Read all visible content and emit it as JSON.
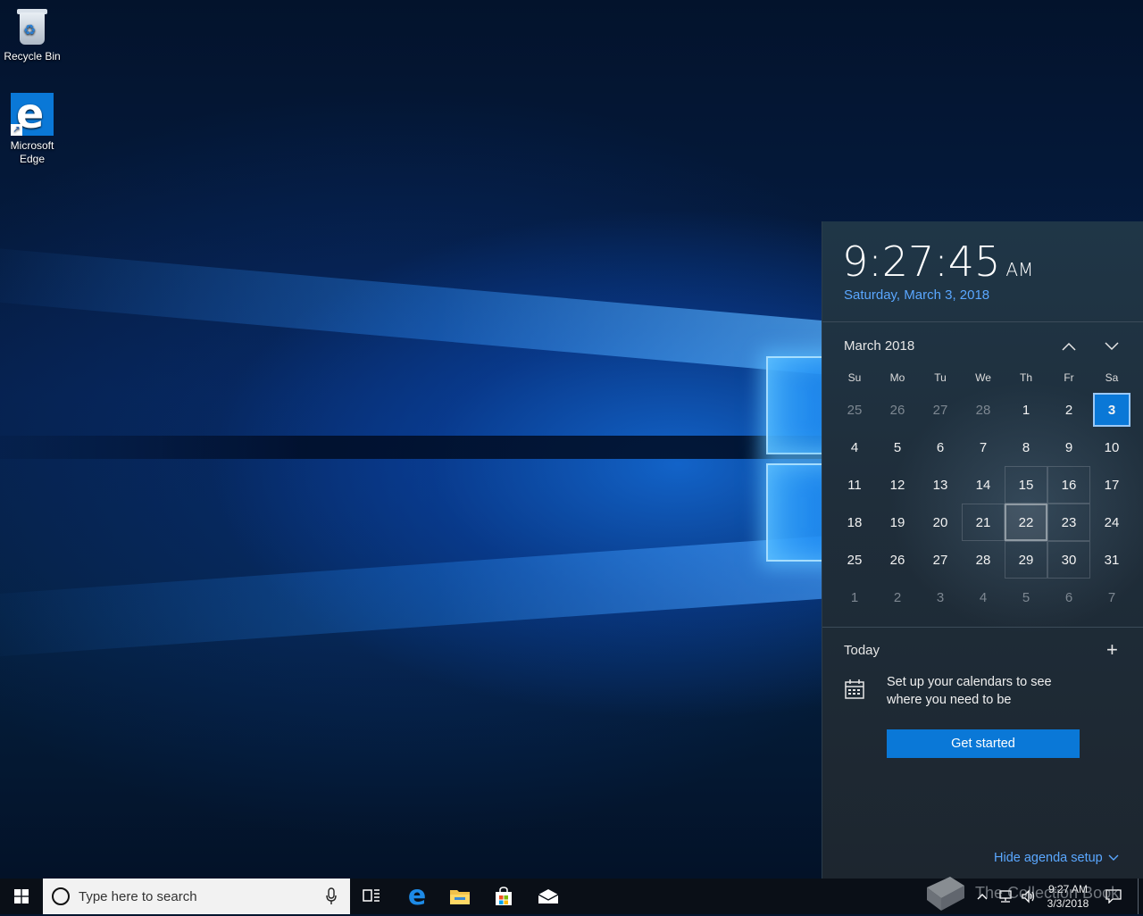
{
  "desktop": {
    "icons": [
      {
        "label": "Recycle Bin",
        "icon": "recycle-bin-icon"
      },
      {
        "label": "Microsoft\nEdge",
        "line1": "Microsoft",
        "line2": "Edge",
        "icon": "edge-icon"
      }
    ]
  },
  "flyout": {
    "time": "9:27:45",
    "ampm": "AM",
    "long_date": "Saturday, March 3, 2018",
    "month_label": "March 2018",
    "weekdays": [
      "Su",
      "Mo",
      "Tu",
      "We",
      "Th",
      "Fr",
      "Sa"
    ],
    "weeks": [
      [
        {
          "d": "25",
          "dim": true
        },
        {
          "d": "26",
          "dim": true
        },
        {
          "d": "27",
          "dim": true
        },
        {
          "d": "28",
          "dim": true
        },
        {
          "d": "1"
        },
        {
          "d": "2"
        },
        {
          "d": "3",
          "today": true
        }
      ],
      [
        {
          "d": "4"
        },
        {
          "d": "5"
        },
        {
          "d": "6"
        },
        {
          "d": "7"
        },
        {
          "d": "8"
        },
        {
          "d": "9"
        },
        {
          "d": "10"
        }
      ],
      [
        {
          "d": "11"
        },
        {
          "d": "12"
        },
        {
          "d": "13"
        },
        {
          "d": "14"
        },
        {
          "d": "15"
        },
        {
          "d": "16"
        },
        {
          "d": "17"
        }
      ],
      [
        {
          "d": "18"
        },
        {
          "d": "19"
        },
        {
          "d": "20"
        },
        {
          "d": "21"
        },
        {
          "d": "22",
          "hover": true
        },
        {
          "d": "23"
        },
        {
          "d": "24"
        }
      ],
      [
        {
          "d": "25"
        },
        {
          "d": "26"
        },
        {
          "d": "27"
        },
        {
          "d": "28"
        },
        {
          "d": "29"
        },
        {
          "d": "30"
        },
        {
          "d": "31"
        }
      ],
      [
        {
          "d": "1",
          "dim": true
        },
        {
          "d": "2",
          "dim": true
        },
        {
          "d": "3",
          "dim": true
        },
        {
          "d": "4",
          "dim": true
        },
        {
          "d": "5",
          "dim": true
        },
        {
          "d": "6",
          "dim": true
        },
        {
          "d": "7",
          "dim": true
        }
      ]
    ],
    "agenda": {
      "today_label": "Today",
      "add_label": "+",
      "setup_text": "Set up your calendars to see where you need to be",
      "get_started_label": "Get started",
      "hide_label": "Hide agenda setup"
    },
    "colors": {
      "accent": "#0a78d7",
      "link": "#5aa7ff"
    }
  },
  "taskbar": {
    "search_placeholder": "Type here to search",
    "tray_time": "9:27 AM",
    "tray_date": "3/3/2018",
    "watermark": "The Collection Book"
  }
}
